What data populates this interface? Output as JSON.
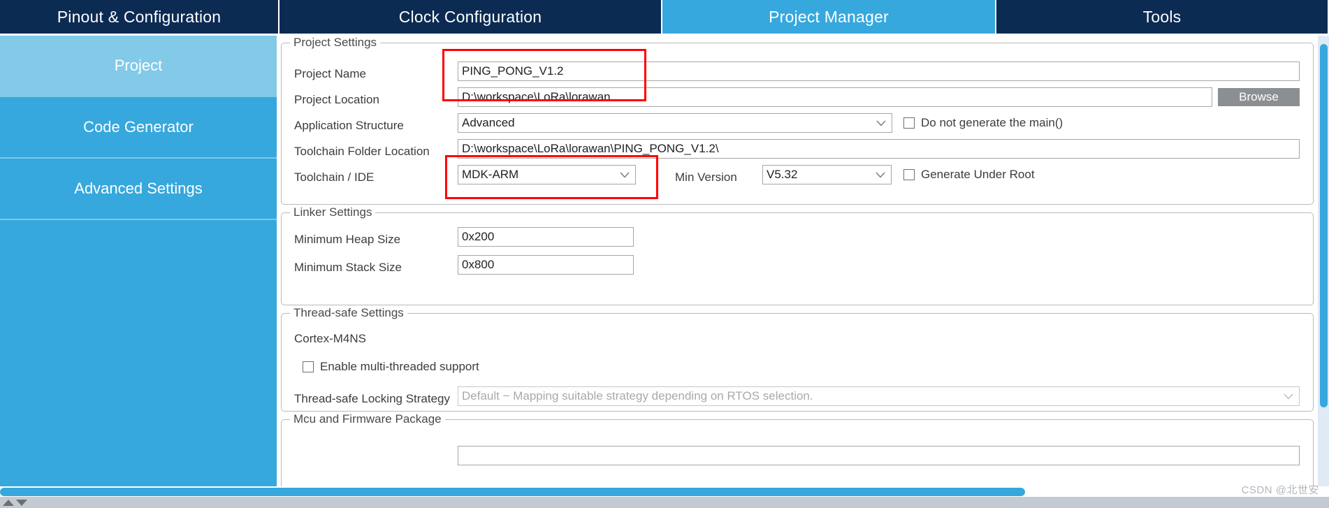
{
  "tabs": [
    {
      "label": "Pinout & Configuration",
      "active": false
    },
    {
      "label": "Clock Configuration",
      "active": false
    },
    {
      "label": "Project Manager",
      "active": true
    },
    {
      "label": "Tools",
      "active": false
    }
  ],
  "sidebar": {
    "items": [
      {
        "label": "Project",
        "selected": true
      },
      {
        "label": "Code Generator",
        "selected": false
      },
      {
        "label": "Advanced Settings",
        "selected": false
      }
    ]
  },
  "project_settings": {
    "title": "Project Settings",
    "project_name_label": "Project Name",
    "project_name_value": "PING_PONG_V1.2",
    "project_location_label": "Project Location",
    "project_location_value": "D:\\workspace\\LoRa\\lorawan",
    "browse_label": "Browse",
    "application_structure_label": "Application Structure",
    "application_structure_value": "Advanced",
    "do_not_generate_main_label": "Do not generate the main()",
    "do_not_generate_main_checked": false,
    "toolchain_folder_label": "Toolchain Folder Location",
    "toolchain_folder_value": "D:\\workspace\\LoRa\\lorawan\\PING_PONG_V1.2\\",
    "toolchain_ide_label": "Toolchain / IDE",
    "toolchain_ide_value": "MDK-ARM",
    "min_version_label": "Min Version",
    "min_version_value": "V5.32",
    "generate_under_root_label": "Generate Under Root",
    "generate_under_root_checked": false
  },
  "linker_settings": {
    "title": "Linker Settings",
    "min_heap_label": "Minimum Heap Size",
    "min_heap_value": "0x200",
    "min_stack_label": "Minimum Stack Size",
    "min_stack_value": "0x800"
  },
  "thread_safe_settings": {
    "title": "Thread-safe Settings",
    "core_label": "Cortex-M4NS",
    "enable_multithread_label": "Enable multi-threaded support",
    "enable_multithread_checked": false,
    "locking_strategy_label": "Thread-safe Locking Strategy",
    "locking_strategy_value": "Default − Mapping suitable strategy depending on RTOS selection."
  },
  "mcu_firmware_package": {
    "title": "Mcu and Firmware Package"
  },
  "watermark": "CSDN @北世安",
  "colors": {
    "tab_inactive_bg": "#0c2b52",
    "tab_active_bg": "#36a8dd",
    "sidebar_bg": "#36a8dd",
    "sidebar_selected_bg": "#83c9e8",
    "highlight_rect": "#ff0000",
    "scrollbar_thumb": "#36a8dd",
    "button_bg": "#8c8f92"
  }
}
